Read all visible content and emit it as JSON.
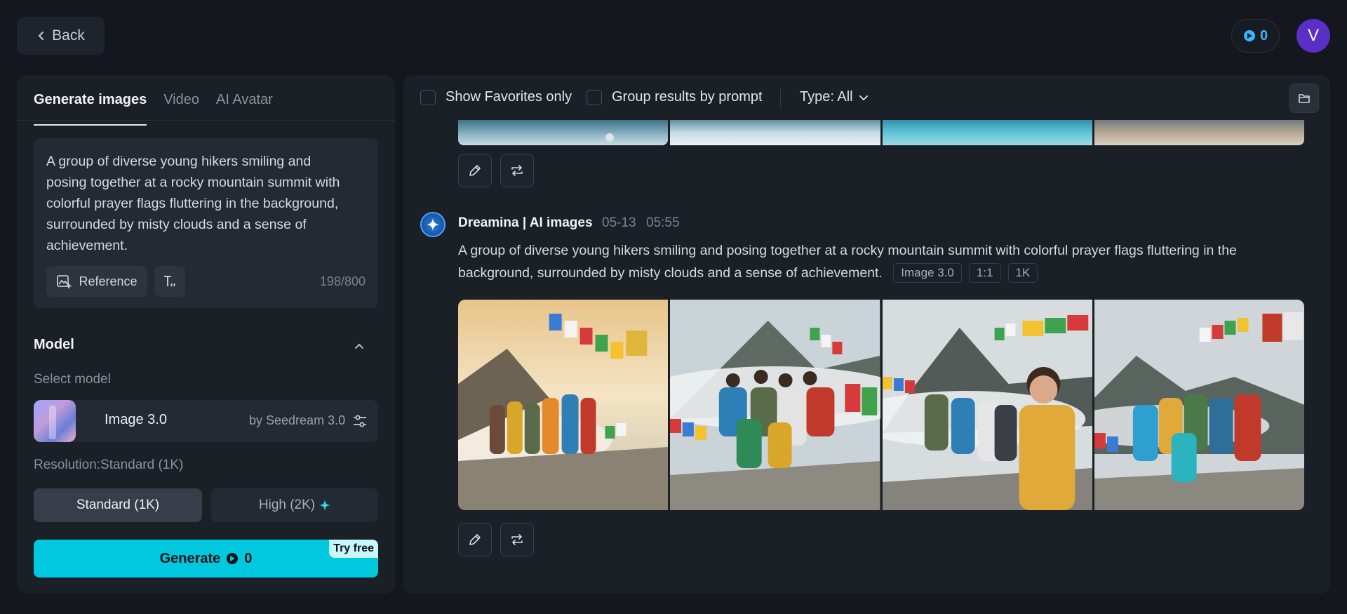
{
  "header": {
    "back_label": "Back",
    "credits": "0",
    "avatar_initial": "V"
  },
  "left_panel": {
    "tabs": [
      {
        "label": "Generate images",
        "active": true
      },
      {
        "label": "Video",
        "active": false
      },
      {
        "label": "AI Avatar",
        "active": false
      }
    ],
    "prompt": {
      "text": "A group of diverse young hikers smiling and posing together at a rocky mountain summit with colorful prayer flags fluttering in the background, surrounded by misty clouds and a sense of achievement.",
      "reference_label": "Reference",
      "char_count": "198/800"
    },
    "model": {
      "title": "Model",
      "select_label": "Select model",
      "name": "Image 3.0",
      "by": "by Seedream 3.0"
    },
    "resolution": {
      "label": "Resolution:Standard (1K)",
      "standard_label": "Standard (1K)",
      "high_label": "High (2K)",
      "selected": "standard"
    },
    "generate": {
      "label": "Generate",
      "cost": "0",
      "badge": "Try free"
    }
  },
  "right_panel": {
    "toolbar": {
      "favorites_label": "Show Favorites only",
      "group_label": "Group results by prompt",
      "type_label": "Type: All"
    },
    "post": {
      "author": "Dreamina | AI images",
      "date": "05-13",
      "time": "05:55",
      "prompt": "A group of diverse young hikers smiling and posing together at a rocky mountain summit with colorful prayer flags fluttering in the background, surrounded by misty clouds and a sense of achievement.",
      "tags": [
        "Image 3.0",
        "1:1",
        "1K"
      ]
    }
  },
  "colors": {
    "accent": "#00c8df",
    "background": "#14171d",
    "panel": "#1b1f26",
    "avatar": "#5a2fc7",
    "credit_icon": "#38b6ff"
  },
  "icons": [
    "chevron-left-icon",
    "credit-icon",
    "reference-icon",
    "text-style-icon",
    "chevron-up-icon",
    "settings-sliders-icon",
    "sparkle-icon",
    "folder-icon",
    "edit-icon",
    "regenerate-icon",
    "dreamina-logo-icon"
  ]
}
